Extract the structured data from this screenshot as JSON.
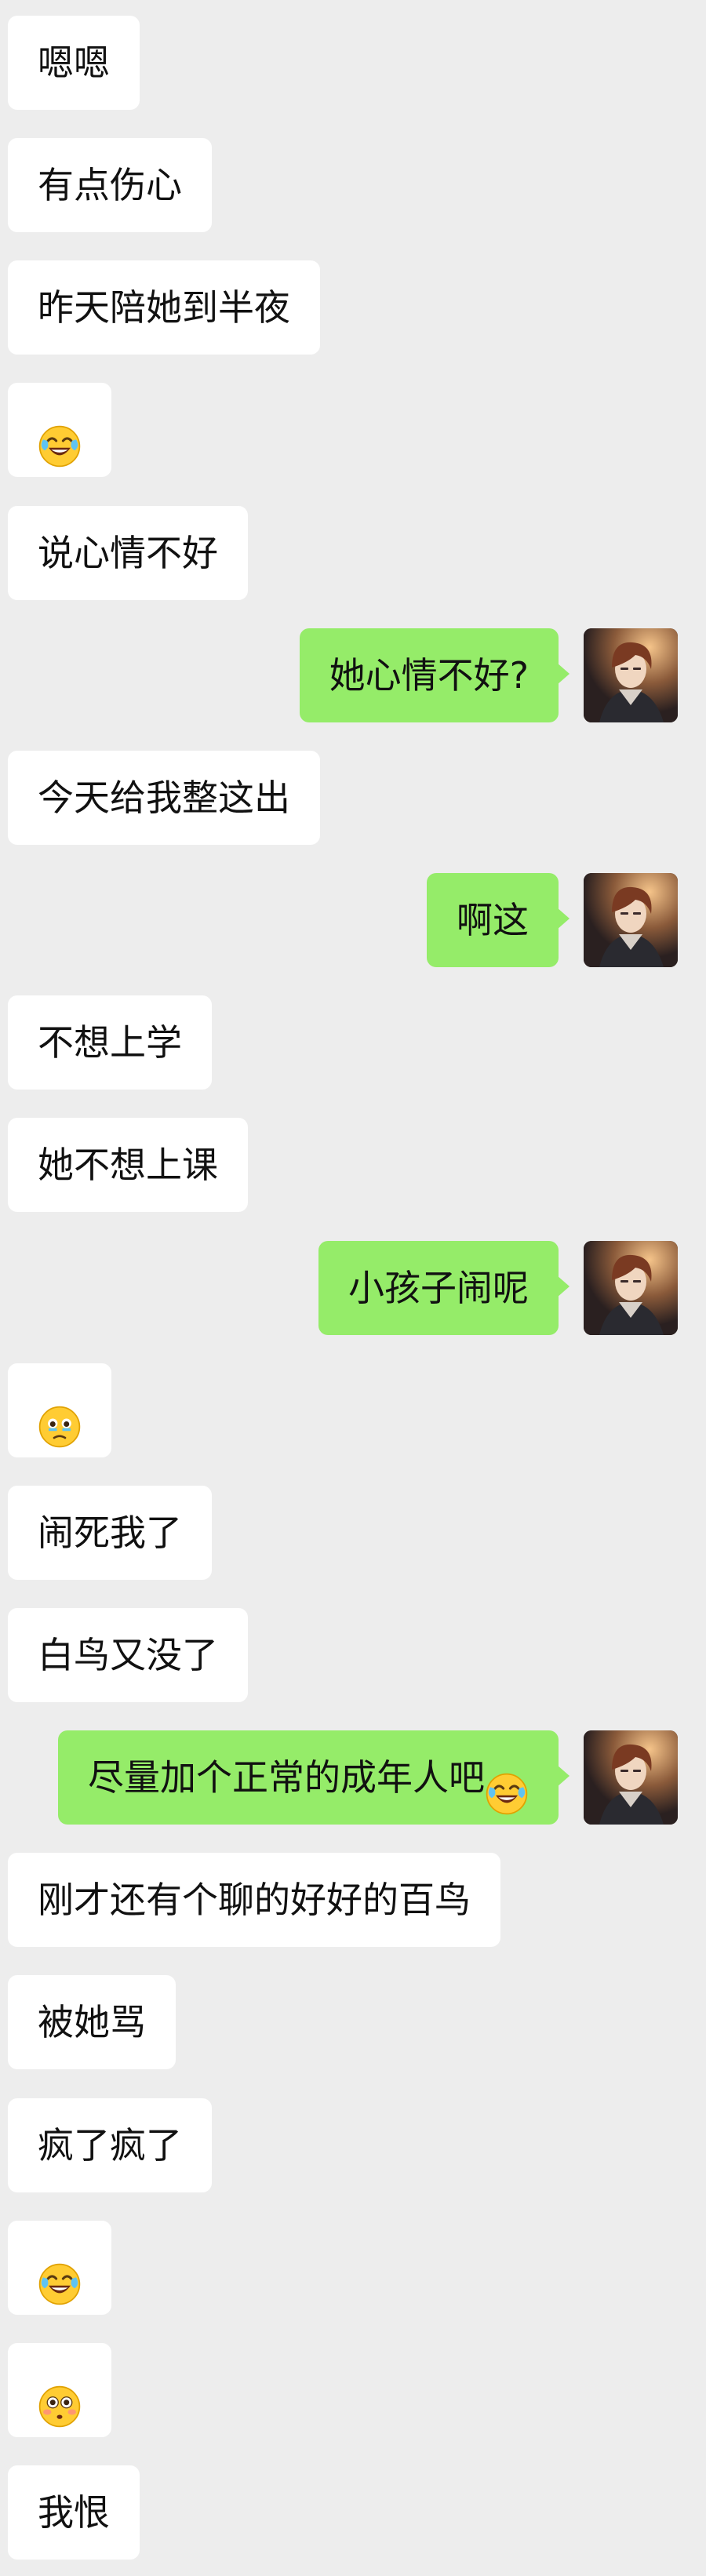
{
  "chat": {
    "self_avatar": "anime-character-avatar",
    "messages": [
      {
        "side": "in",
        "text": "嗯嗯"
      },
      {
        "side": "in",
        "text": "有点伤心"
      },
      {
        "side": "in",
        "text": "昨天陪她到半夜"
      },
      {
        "side": "in",
        "text": "",
        "emoji": "laughing-crying-face"
      },
      {
        "side": "in",
        "text": "说心情不好"
      },
      {
        "side": "out",
        "text": "她心情不好?"
      },
      {
        "side": "in",
        "text": "今天给我整这出"
      },
      {
        "side": "out",
        "text": "啊这"
      },
      {
        "side": "in",
        "text": "不想上学"
      },
      {
        "side": "in",
        "text": "她不想上课"
      },
      {
        "side": "out",
        "text": "小孩子闹呢"
      },
      {
        "side": "in",
        "text": "",
        "emoji": "teary-face"
      },
      {
        "side": "in",
        "text": "闹死我了"
      },
      {
        "side": "in",
        "text": "白鸟又没了"
      },
      {
        "side": "out",
        "text": "尽量加个正常的成年人吧",
        "emoji": "laughing-crying-face"
      },
      {
        "side": "in",
        "text": "刚才还有个聊的好好的百鸟"
      },
      {
        "side": "in",
        "text": "被她骂"
      },
      {
        "side": "in",
        "text": "疯了疯了"
      },
      {
        "side": "in",
        "text": "",
        "emoji": "laughing-crying-face"
      },
      {
        "side": "in",
        "text": "",
        "emoji": "flushed-face"
      },
      {
        "side": "in",
        "text": "我恨"
      }
    ]
  },
  "colors": {
    "background": "#ededed",
    "incoming_bubble": "#ffffff",
    "outgoing_bubble": "#95ec69",
    "text": "#111111"
  }
}
